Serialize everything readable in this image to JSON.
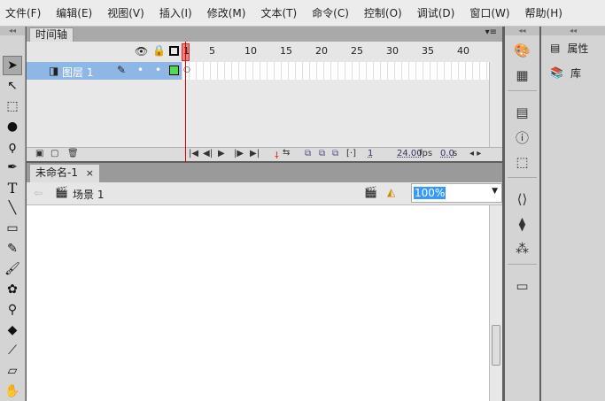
{
  "menu": [
    "文件(F)",
    "编辑(E)",
    "视图(V)",
    "插入(I)",
    "修改(M)",
    "文本(T)",
    "命令(C)",
    "控制(O)",
    "调试(D)",
    "窗口(W)",
    "帮助(H)"
  ],
  "timeline": {
    "tab": "时间轴",
    "frame_numbers": [
      "1",
      "5",
      "10",
      "15",
      "20",
      "25",
      "30",
      "35",
      "40"
    ],
    "layer": {
      "name": "图层 1"
    },
    "current_frame": "1",
    "fps": "24.00",
    "fps_unit": "fps",
    "time": "0.0",
    "time_unit": "s"
  },
  "document": {
    "tab": "未命名-1",
    "close": "×",
    "scene": "场景 1",
    "zoom": "100%"
  },
  "right_panels": {
    "properties": "属性",
    "library": "库"
  }
}
